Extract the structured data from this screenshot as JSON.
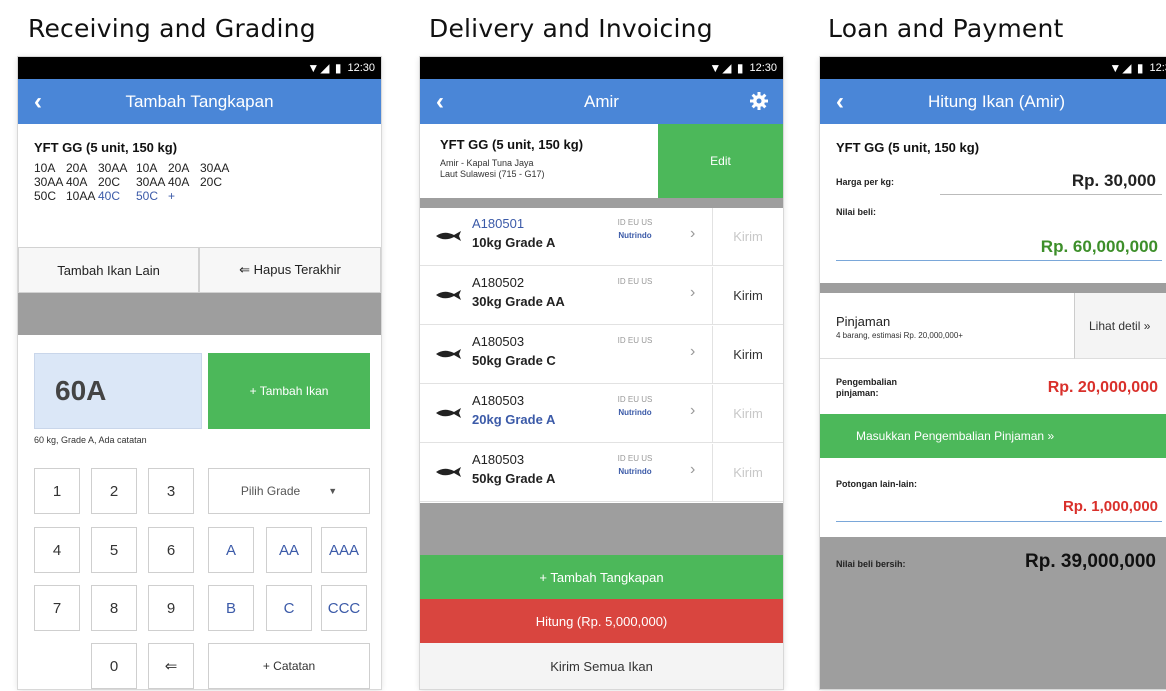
{
  "titles": {
    "receiving": "Receiving and Grading",
    "delivery": "Delivery and Invoicing",
    "loan": "Loan and Payment"
  },
  "status_time": "12:30",
  "screen1": {
    "appbar_title": "Tambah Tangkapan",
    "fish_summary": "YFT GG (5 unit, 150 kg)",
    "grades": [
      [
        "10A",
        "20A",
        "30AA",
        "10A",
        "20A",
        "30AA"
      ],
      [
        "30AA",
        "40A",
        "20C",
        "30AA",
        "40A",
        "20C"
      ],
      [
        "50C",
        "10AA",
        "40C",
        "50C",
        "+"
      ]
    ],
    "btn_add_other": "Tambah Ikan Lain",
    "btn_delete_last": "⇐ Hapus Terakhir",
    "current_value": "60A",
    "btn_add_fish": "+ Tambah Ikan",
    "note": "60 kg, Grade A, Ada catatan",
    "keys": [
      "1",
      "2",
      "3",
      "4",
      "5",
      "6",
      "7",
      "8",
      "9",
      "0",
      "⇐"
    ],
    "select_grade": "Pilih Grade",
    "grade_keys": [
      "A",
      "AA",
      "AAA",
      "B",
      "C",
      "CCC"
    ],
    "btn_note": "+ Catatan"
  },
  "screen2": {
    "appbar_title": "Amir",
    "fish_summary": "YFT GG (5 unit, 150 kg)",
    "owner_line1": "Amir - Kapal Tuna Jaya",
    "owner_line2": "Laut Sulawesi (715 - G17)",
    "btn_edit": "Edit",
    "items": [
      {
        "code": "A180501",
        "grade": "10kg Grade A",
        "tags": "ID EU US",
        "buyer": "Nutrindo",
        "send": "Kirim"
      },
      {
        "code": "A180502",
        "grade": "30kg Grade AA",
        "tags": "ID EU US",
        "buyer": "",
        "send": "Kirim"
      },
      {
        "code": "A180503",
        "grade": "50kg Grade C",
        "tags": "ID EU US",
        "buyer": "",
        "send": "Kirim"
      },
      {
        "code": "A180503",
        "grade": "20kg Grade A",
        "tags": "ID EU US",
        "buyer": "Nutrindo",
        "send": "Kirim"
      },
      {
        "code": "A180503",
        "grade": "50kg Grade A",
        "tags": "ID EU US",
        "buyer": "Nutrindo",
        "send": "Kirim"
      }
    ],
    "btn_add_catch": "+ Tambah Tangkapan",
    "btn_calculate": "Hitung (Rp. 5,000,000)",
    "btn_send_all": "Kirim Semua Ikan"
  },
  "screen3": {
    "appbar_title": "Hitung Ikan (Amir)",
    "fish_summary": "YFT GG (5 unit, 150 kg)",
    "price_label": "Harga per kg:",
    "price_value": "Rp. 30,000",
    "buy_label": "Nilai beli:",
    "buy_value": "Rp. 60,000,000",
    "loan_label": "Pinjaman",
    "loan_sub": "4 barang, estimasi Rp. 20,000,000+",
    "loan_detail": "Lihat detil »",
    "repay_label_1": "Pengembalian",
    "repay_label_2": "pinjaman:",
    "repay_value": "Rp. 20,000,000",
    "btn_repay": "Masukkan Pengembalian Pinjaman »",
    "other_label": "Potongan lain-lain:",
    "other_value": "Rp. 1,000,000",
    "net_label": "Nilai beli bersih:",
    "net_value": "Rp. 39,000,000"
  },
  "colors": {
    "appbar": "#4a86d7",
    "green": "#4cb85a",
    "red": "#d9453f",
    "grade_blue": "#3b5aa8"
  }
}
